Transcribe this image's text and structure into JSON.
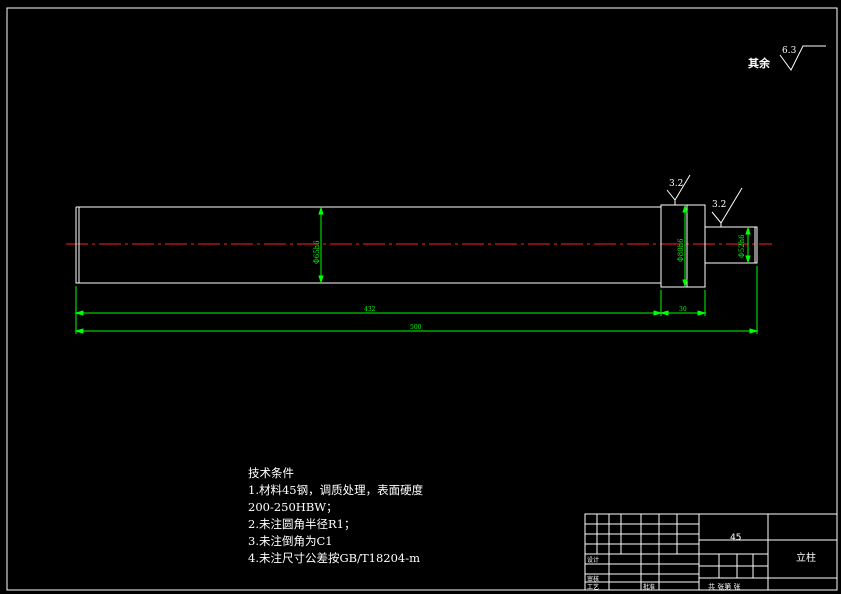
{
  "surface_finish": {
    "general_label": "其余",
    "general_value": "6.3",
    "value_a": "3.2",
    "value_b": "3.2"
  },
  "dimensions": {
    "dia_main": "Φ65h6",
    "dia_collar": "Φ80h6",
    "dia_tip": "Φ52h6",
    "len_main": "432",
    "len_collar": "30",
    "len_total": "500"
  },
  "tech_notes": {
    "title": "技术条件",
    "lines": [
      "1.材料45钢，调质处理，表面硬度",
      "200-250HBW；",
      "2.未注圆角半径R1；",
      "3.未注倒角为C1",
      "4.未注尺寸公差按GB/T18204-m"
    ]
  },
  "title_block": {
    "material": "45",
    "part_name": "立柱",
    "design_label": "设计",
    "check_label": "审核",
    "process_label": "工艺",
    "approve_label": "批准",
    "sheet_text": "共 张第 张"
  },
  "colors": {
    "outline": "#ffffff",
    "dimension": "#00ff00",
    "centerline": "#ff2020"
  }
}
